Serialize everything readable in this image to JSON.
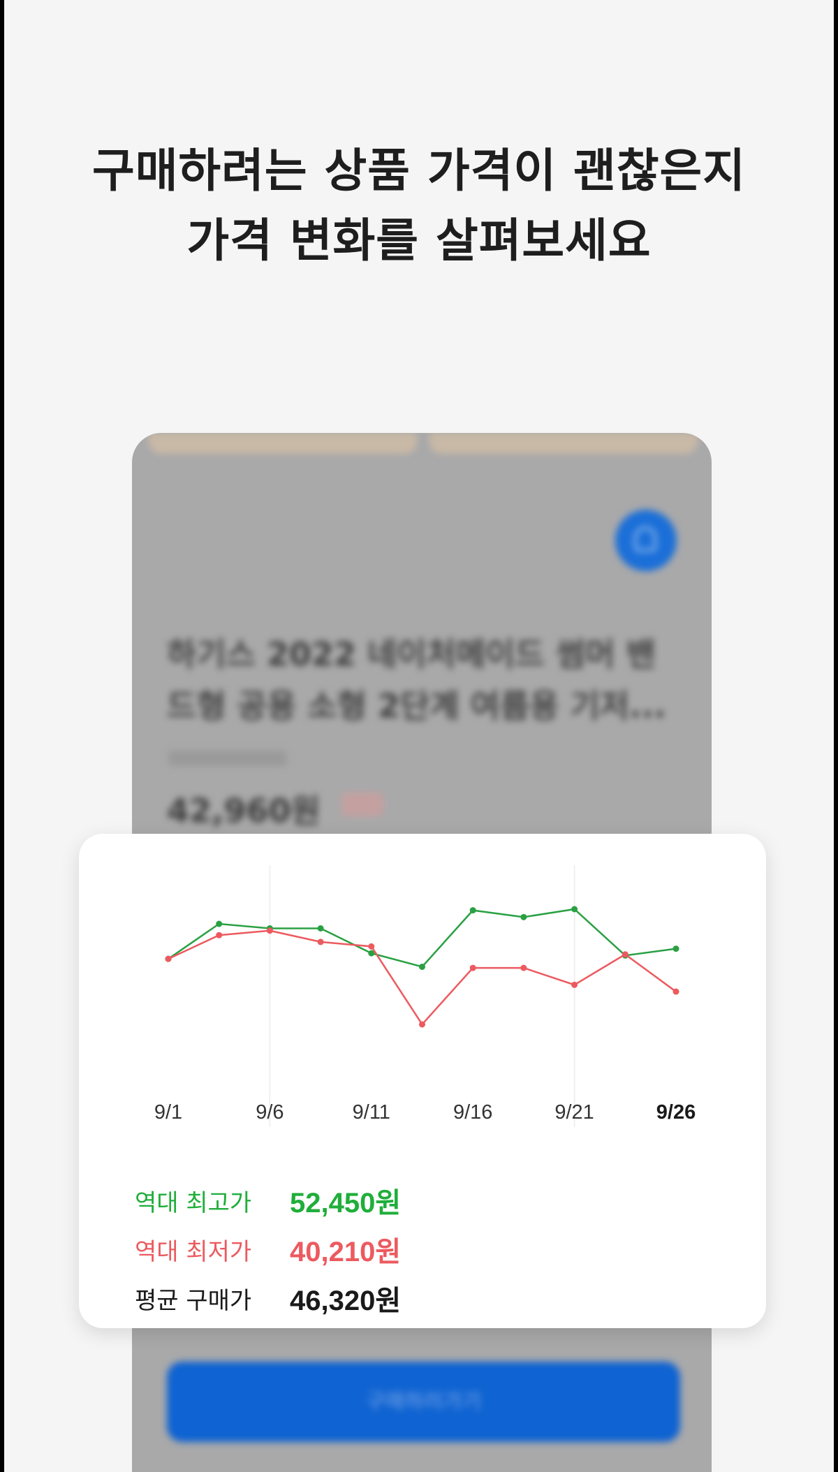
{
  "headline": {
    "line1": "구매하려는 상품 가격이 괜찮은지",
    "line2": "가격 변화를 살펴보세요"
  },
  "background_card": {
    "product_title_line1": "하기스 2022 네이처메이드 썸머 밴",
    "product_title_line2": "드형 공용 소형 2단계 여름용 기저...",
    "price": "42,960원",
    "buy_button_label": "구매하러가기",
    "alert_icon": "bell-icon"
  },
  "price_card": {
    "stats": [
      {
        "label": "역대 최고가",
        "value": "52,450원",
        "color": "#1fae3a"
      },
      {
        "label": "역대 최저가",
        "value": "40,210원",
        "color": "#ec5a5f"
      },
      {
        "label": "평균 구매가",
        "value": "46,320원",
        "color": "#1a1a1a"
      }
    ]
  },
  "chart_data": {
    "type": "line",
    "x_tick_labels": [
      "9/1",
      "9/6",
      "9/11",
      "9/16",
      "9/21",
      "9/26"
    ],
    "x_values": [
      1,
      3.5,
      6,
      8.5,
      11,
      13.5,
      16,
      18.5,
      21,
      23.5,
      26
    ],
    "series": [
      {
        "color": "#2aa043",
        "values": [
          48300,
          51400,
          51000,
          51000,
          48800,
          47600,
          52600,
          52000,
          52700,
          48600,
          49200
        ]
      },
      {
        "color": "#ec5a5f",
        "values": [
          48300,
          50400,
          50800,
          49800,
          49400,
          42500,
          47500,
          47500,
          46000,
          48700,
          45400
        ]
      }
    ],
    "ylim": [
      40210,
      52700
    ],
    "grid": "vertical lines at every other tick",
    "legend": "none"
  }
}
